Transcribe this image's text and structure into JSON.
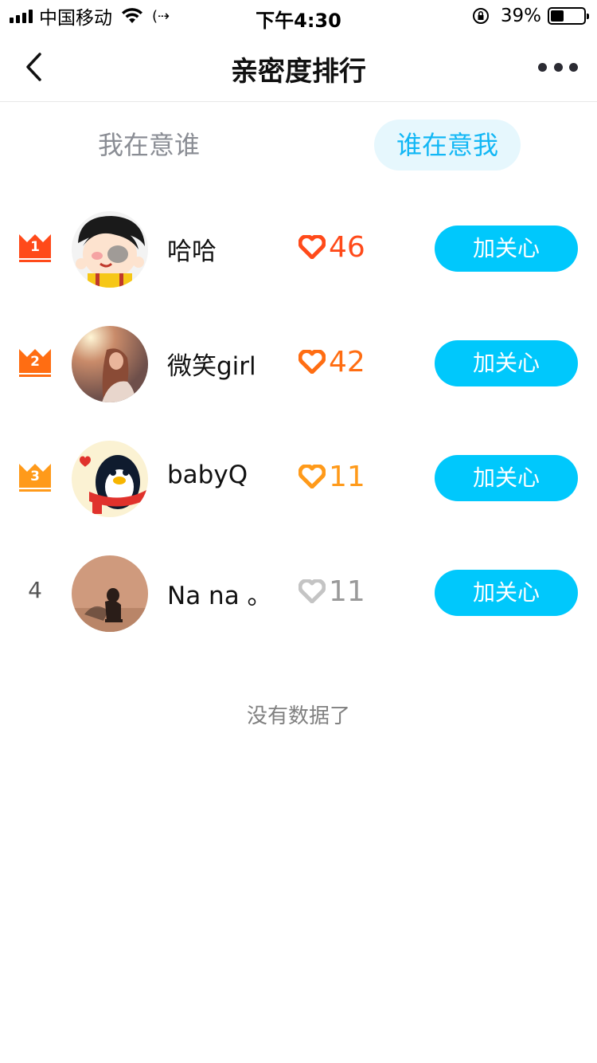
{
  "status_bar": {
    "carrier": "中国移动",
    "time": "下午4:30",
    "battery_percent": "39%",
    "battery_level": 0.39,
    "icons": [
      "signal-icon",
      "wifi-icon",
      "hotspot-icon",
      "rotation-lock-icon",
      "battery-icon"
    ]
  },
  "nav": {
    "title": "亲密度排行",
    "back_icon": "chevron-left-icon",
    "more_icon": "more-dots-icon"
  },
  "tabs": [
    {
      "label": "我在意谁",
      "selected": false
    },
    {
      "label": "谁在意我",
      "selected": true
    }
  ],
  "list": [
    {
      "rank": "1",
      "name": "哈哈",
      "score": "46",
      "button": "加关心",
      "heart_color": "#ff4a1a",
      "crown_color": "#ff4a1a",
      "score_color": "#ff4a1a"
    },
    {
      "rank": "2",
      "name": "微笑girl",
      "score": "42",
      "button": "加关心",
      "heart_color": "#ff6d12",
      "crown_color": "#ff6d12",
      "score_color": "#ff6d12"
    },
    {
      "rank": "3",
      "name": "babyQ",
      "score": "11",
      "button": "加关心",
      "heart_color": "#ff9a1a",
      "crown_color": "#ff9a1a",
      "score_color": "#ff9a1a"
    },
    {
      "rank": "4",
      "name": "Na na 。",
      "score": "11",
      "button": "加关心",
      "heart_color": "#c4c4c4",
      "score_color": "#9a9a9a"
    }
  ],
  "footer": {
    "text": "没有数据了"
  },
  "colors": {
    "accent": "#00c8fc",
    "tab_selected_text": "#12b7f5",
    "tab_selected_bg": "#e6f7fd"
  }
}
